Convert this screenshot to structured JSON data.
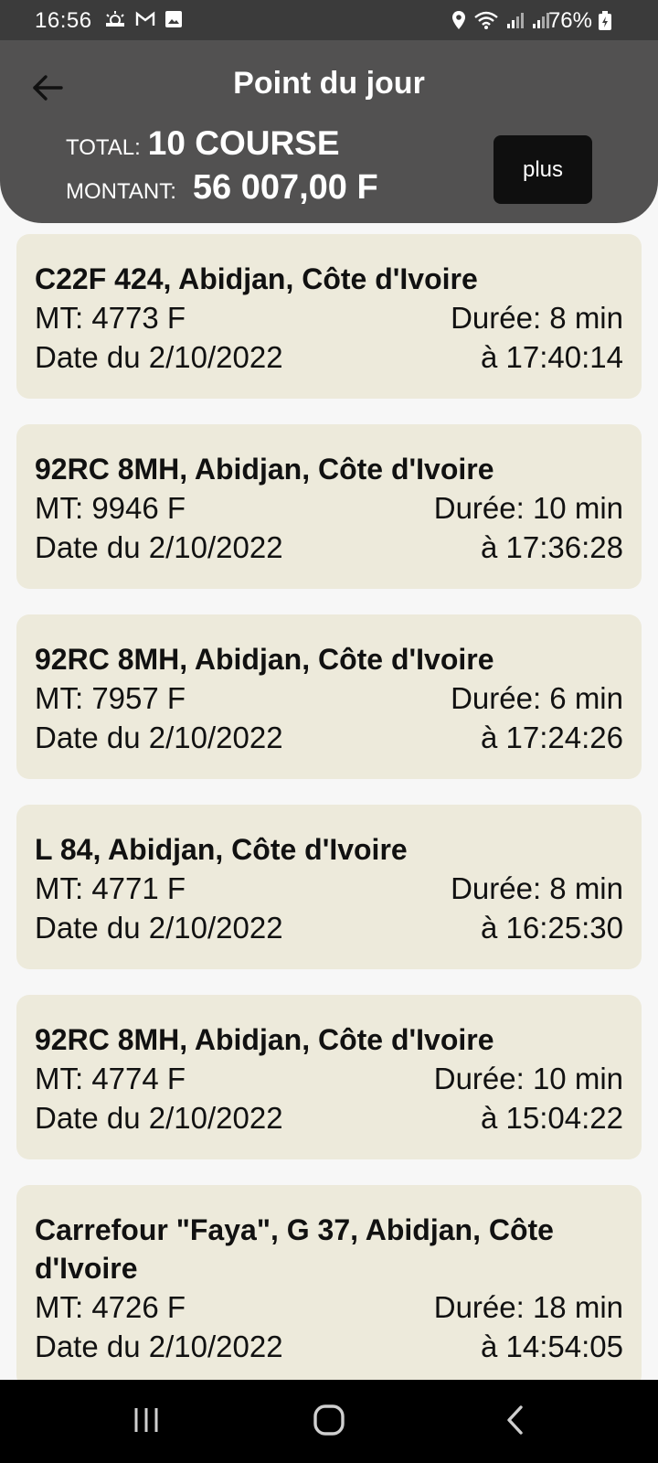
{
  "status_bar": {
    "time": "16:56",
    "battery": "76%",
    "left_icons": [
      "weather-icon",
      "gmail-icon",
      "gallery-icon"
    ],
    "right_icons": [
      "location-icon",
      "wifi-icon",
      "signal-icon",
      "signal-icon",
      "battery-icon"
    ]
  },
  "header": {
    "title": "Point du jour",
    "total_label": "TOTAL:",
    "total_value": "10 COURSE",
    "amount_label": "MONTANT:",
    "amount_value": "56 007,00 F",
    "plus_label": "plus"
  },
  "rides": [
    {
      "address": "C22F 424, Abidjan, Côte d'Ivoire",
      "amount": "MT: 4773 F",
      "duration": "Durée: 8 min",
      "date": "Date du 2/10/2022",
      "time": "à 17:40:14"
    },
    {
      "address": "92RC 8MH, Abidjan, Côte d'Ivoire",
      "amount": "MT: 9946 F",
      "duration": "Durée: 10 min",
      "date": "Date du 2/10/2022",
      "time": "à 17:36:28"
    },
    {
      "address": "92RC 8MH, Abidjan, Côte d'Ivoire",
      "amount": "MT: 7957 F",
      "duration": "Durée: 6 min",
      "date": "Date du 2/10/2022",
      "time": "à 17:24:26"
    },
    {
      "address": "L 84, Abidjan, Côte d'Ivoire",
      "amount": "MT: 4771 F",
      "duration": "Durée: 8 min",
      "date": "Date du 2/10/2022",
      "time": "à 16:25:30"
    },
    {
      "address": "92RC 8MH, Abidjan, Côte d'Ivoire",
      "amount": "MT: 4774 F",
      "duration": "Durée: 10 min",
      "date": "Date du 2/10/2022",
      "time": "à 15:04:22"
    },
    {
      "address": "Carrefour \"Faya\", G 37, Abidjan, Côte d'Ivoire",
      "amount": "MT: 4726 F",
      "duration": "Durée: 18 min",
      "date": "Date du 2/10/2022",
      "time": "à 14:54:05"
    }
  ],
  "colors": {
    "status_bar": "#3b3b3b",
    "header": "#525151",
    "plus_button": "#0f0f0f",
    "card": "#edeadb",
    "background": "#f7f7f7",
    "nav_bar": "#000000"
  },
  "nav_icons": [
    "recents-icon",
    "home-icon",
    "back-nav-icon"
  ]
}
